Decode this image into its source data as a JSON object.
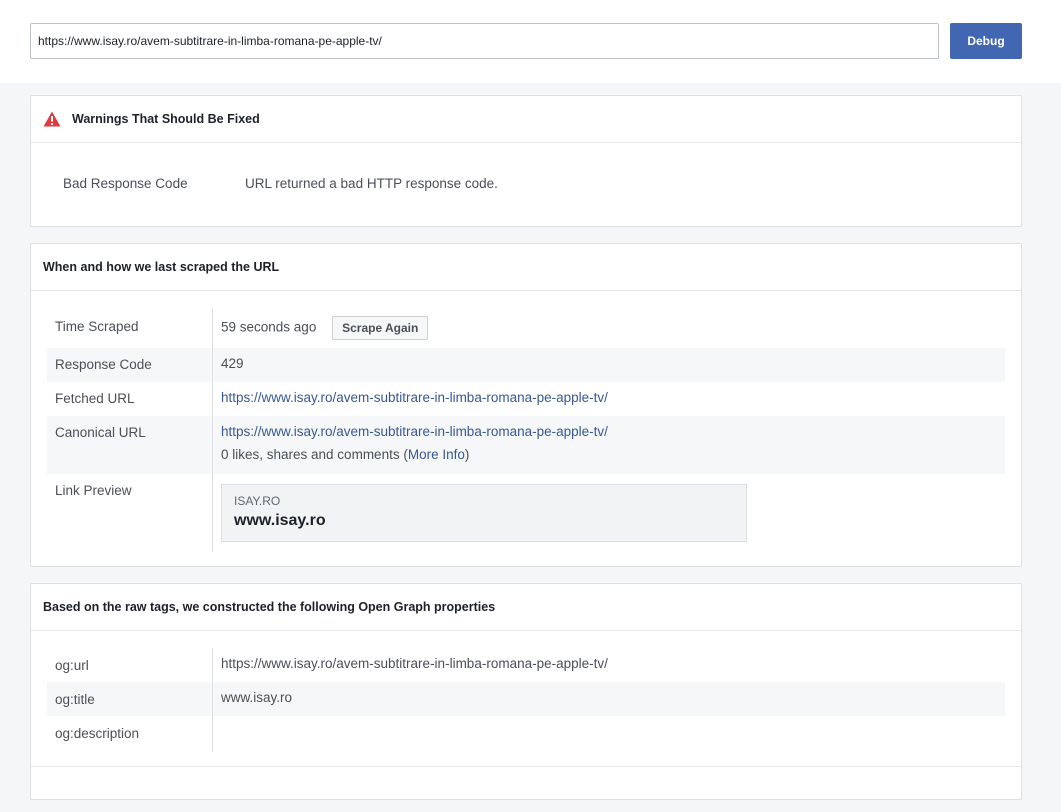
{
  "search": {
    "value": "https://www.isay.ro/avem-subtitrare-in-limba-romana-pe-apple-tv/",
    "debug_label": "Debug"
  },
  "warnings": {
    "title": "Warnings That Should Be Fixed",
    "items": [
      {
        "label": "Bad Response Code",
        "message": "URL returned a bad HTTP response code."
      }
    ]
  },
  "scrape": {
    "title": "When and how we last scraped the URL",
    "time_scraped_label": "Time Scraped",
    "time_scraped_value": "59 seconds ago",
    "scrape_again_label": "Scrape Again",
    "response_code_label": "Response Code",
    "response_code_value": "429",
    "fetched_url_label": "Fetched URL",
    "fetched_url_value": "https://www.isay.ro/avem-subtitrare-in-limba-romana-pe-apple-tv/",
    "canonical_url_label": "Canonical URL",
    "canonical_url_value": "https://www.isay.ro/avem-subtitrare-in-limba-romana-pe-apple-tv/",
    "engagement_text": "0 likes, shares and comments (",
    "more_info_label": "More Info",
    "engagement_close": ")",
    "link_preview_label": "Link Preview",
    "preview_domain": "ISAY.RO",
    "preview_title": "www.isay.ro"
  },
  "og": {
    "title": "Based on the raw tags, we constructed the following Open Graph properties",
    "rows": [
      {
        "key": "og:url",
        "value": "https://www.isay.ro/avem-subtitrare-in-limba-romana-pe-apple-tv/"
      },
      {
        "key": "og:title",
        "value": "www.isay.ro"
      },
      {
        "key": "og:description",
        "value": ""
      }
    ]
  },
  "colors": {
    "accent": "#4267b2",
    "link": "#365899",
    "warning": "#e0393e"
  }
}
